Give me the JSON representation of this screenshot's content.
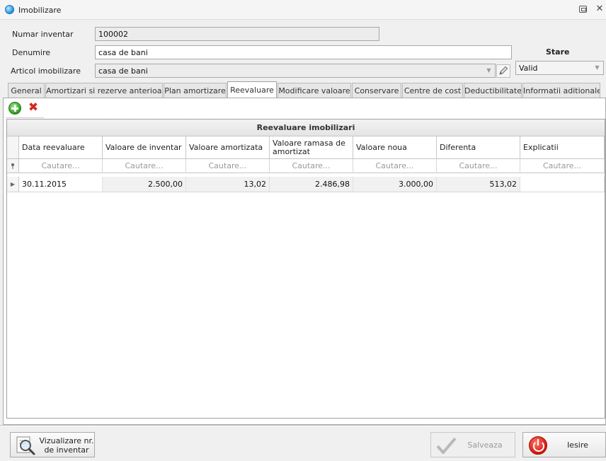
{
  "window": {
    "title": "Imobilizare",
    "restore_icon": "restore-icon",
    "close_glyph": "✕"
  },
  "form": {
    "numar_inventar_label": "Numar inventar",
    "numar_inventar_value": "100002",
    "denumire_label": "Denumire",
    "denumire_value": "casa de bani",
    "articol_label": "Articol imobilizare",
    "articol_value": "casa de bani",
    "stare_label": "Stare",
    "stare_value": "Valid"
  },
  "tabs": [
    {
      "label": "General"
    },
    {
      "label": "Amortizari si rezerve anterioare"
    },
    {
      "label": "Plan amortizare"
    },
    {
      "label": "Reevaluare"
    },
    {
      "label": "Modificare valoare"
    },
    {
      "label": "Conservare"
    },
    {
      "label": "Centre de cost"
    },
    {
      "label": "Deductibilitate"
    },
    {
      "label": "Informatii aditionale"
    }
  ],
  "active_tab": "Reevaluare",
  "toolbar": {
    "add_icon": "plus-icon",
    "delete_icon": "delete-icon"
  },
  "grid": {
    "group_title": "Reevaluare imobilizari",
    "columns": [
      "Data reevaluare",
      "Valoare de inventar",
      "Valoare amortizata",
      "Valoare ramasa de amortizat",
      "Valoare noua",
      "Diferenta",
      "Explicatii"
    ],
    "filter_placeholder": "Cautare...",
    "rows": [
      [
        "30.11.2015",
        "2.500,00",
        "13,02",
        "2.486,98",
        "3.000,00",
        "513,02",
        ""
      ]
    ]
  },
  "footer": {
    "view_button": "Vizualizare nr. de inventar",
    "view_button_line1": "Vizualizare nr.",
    "view_button_line2": "de inventar",
    "save_button": "Salveaza",
    "exit_button": "Iesire"
  },
  "colors": {
    "accent": "#1d8fd6",
    "exit_red": "#d3140a",
    "add_green": "#2e9b20"
  }
}
